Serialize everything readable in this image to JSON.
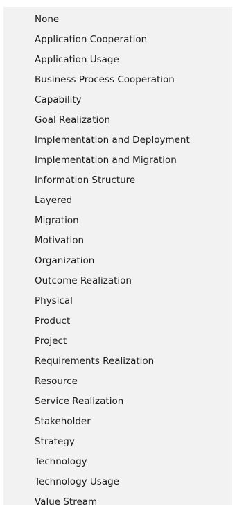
{
  "menu": {
    "items": [
      {
        "label": "None"
      },
      {
        "label": "Application Cooperation"
      },
      {
        "label": "Application Usage"
      },
      {
        "label": "Business Process Cooperation"
      },
      {
        "label": "Capability"
      },
      {
        "label": "Goal Realization"
      },
      {
        "label": "Implementation and Deployment"
      },
      {
        "label": "Implementation and Migration"
      },
      {
        "label": "Information Structure"
      },
      {
        "label": "Layered"
      },
      {
        "label": "Migration"
      },
      {
        "label": "Motivation"
      },
      {
        "label": "Organization"
      },
      {
        "label": "Outcome Realization"
      },
      {
        "label": "Physical"
      },
      {
        "label": "Product"
      },
      {
        "label": "Project"
      },
      {
        "label": "Requirements Realization"
      },
      {
        "label": "Resource"
      },
      {
        "label": "Service Realization"
      },
      {
        "label": "Stakeholder"
      },
      {
        "label": "Strategy"
      },
      {
        "label": "Technology"
      },
      {
        "label": "Technology Usage"
      },
      {
        "label": "Value Stream"
      }
    ]
  }
}
